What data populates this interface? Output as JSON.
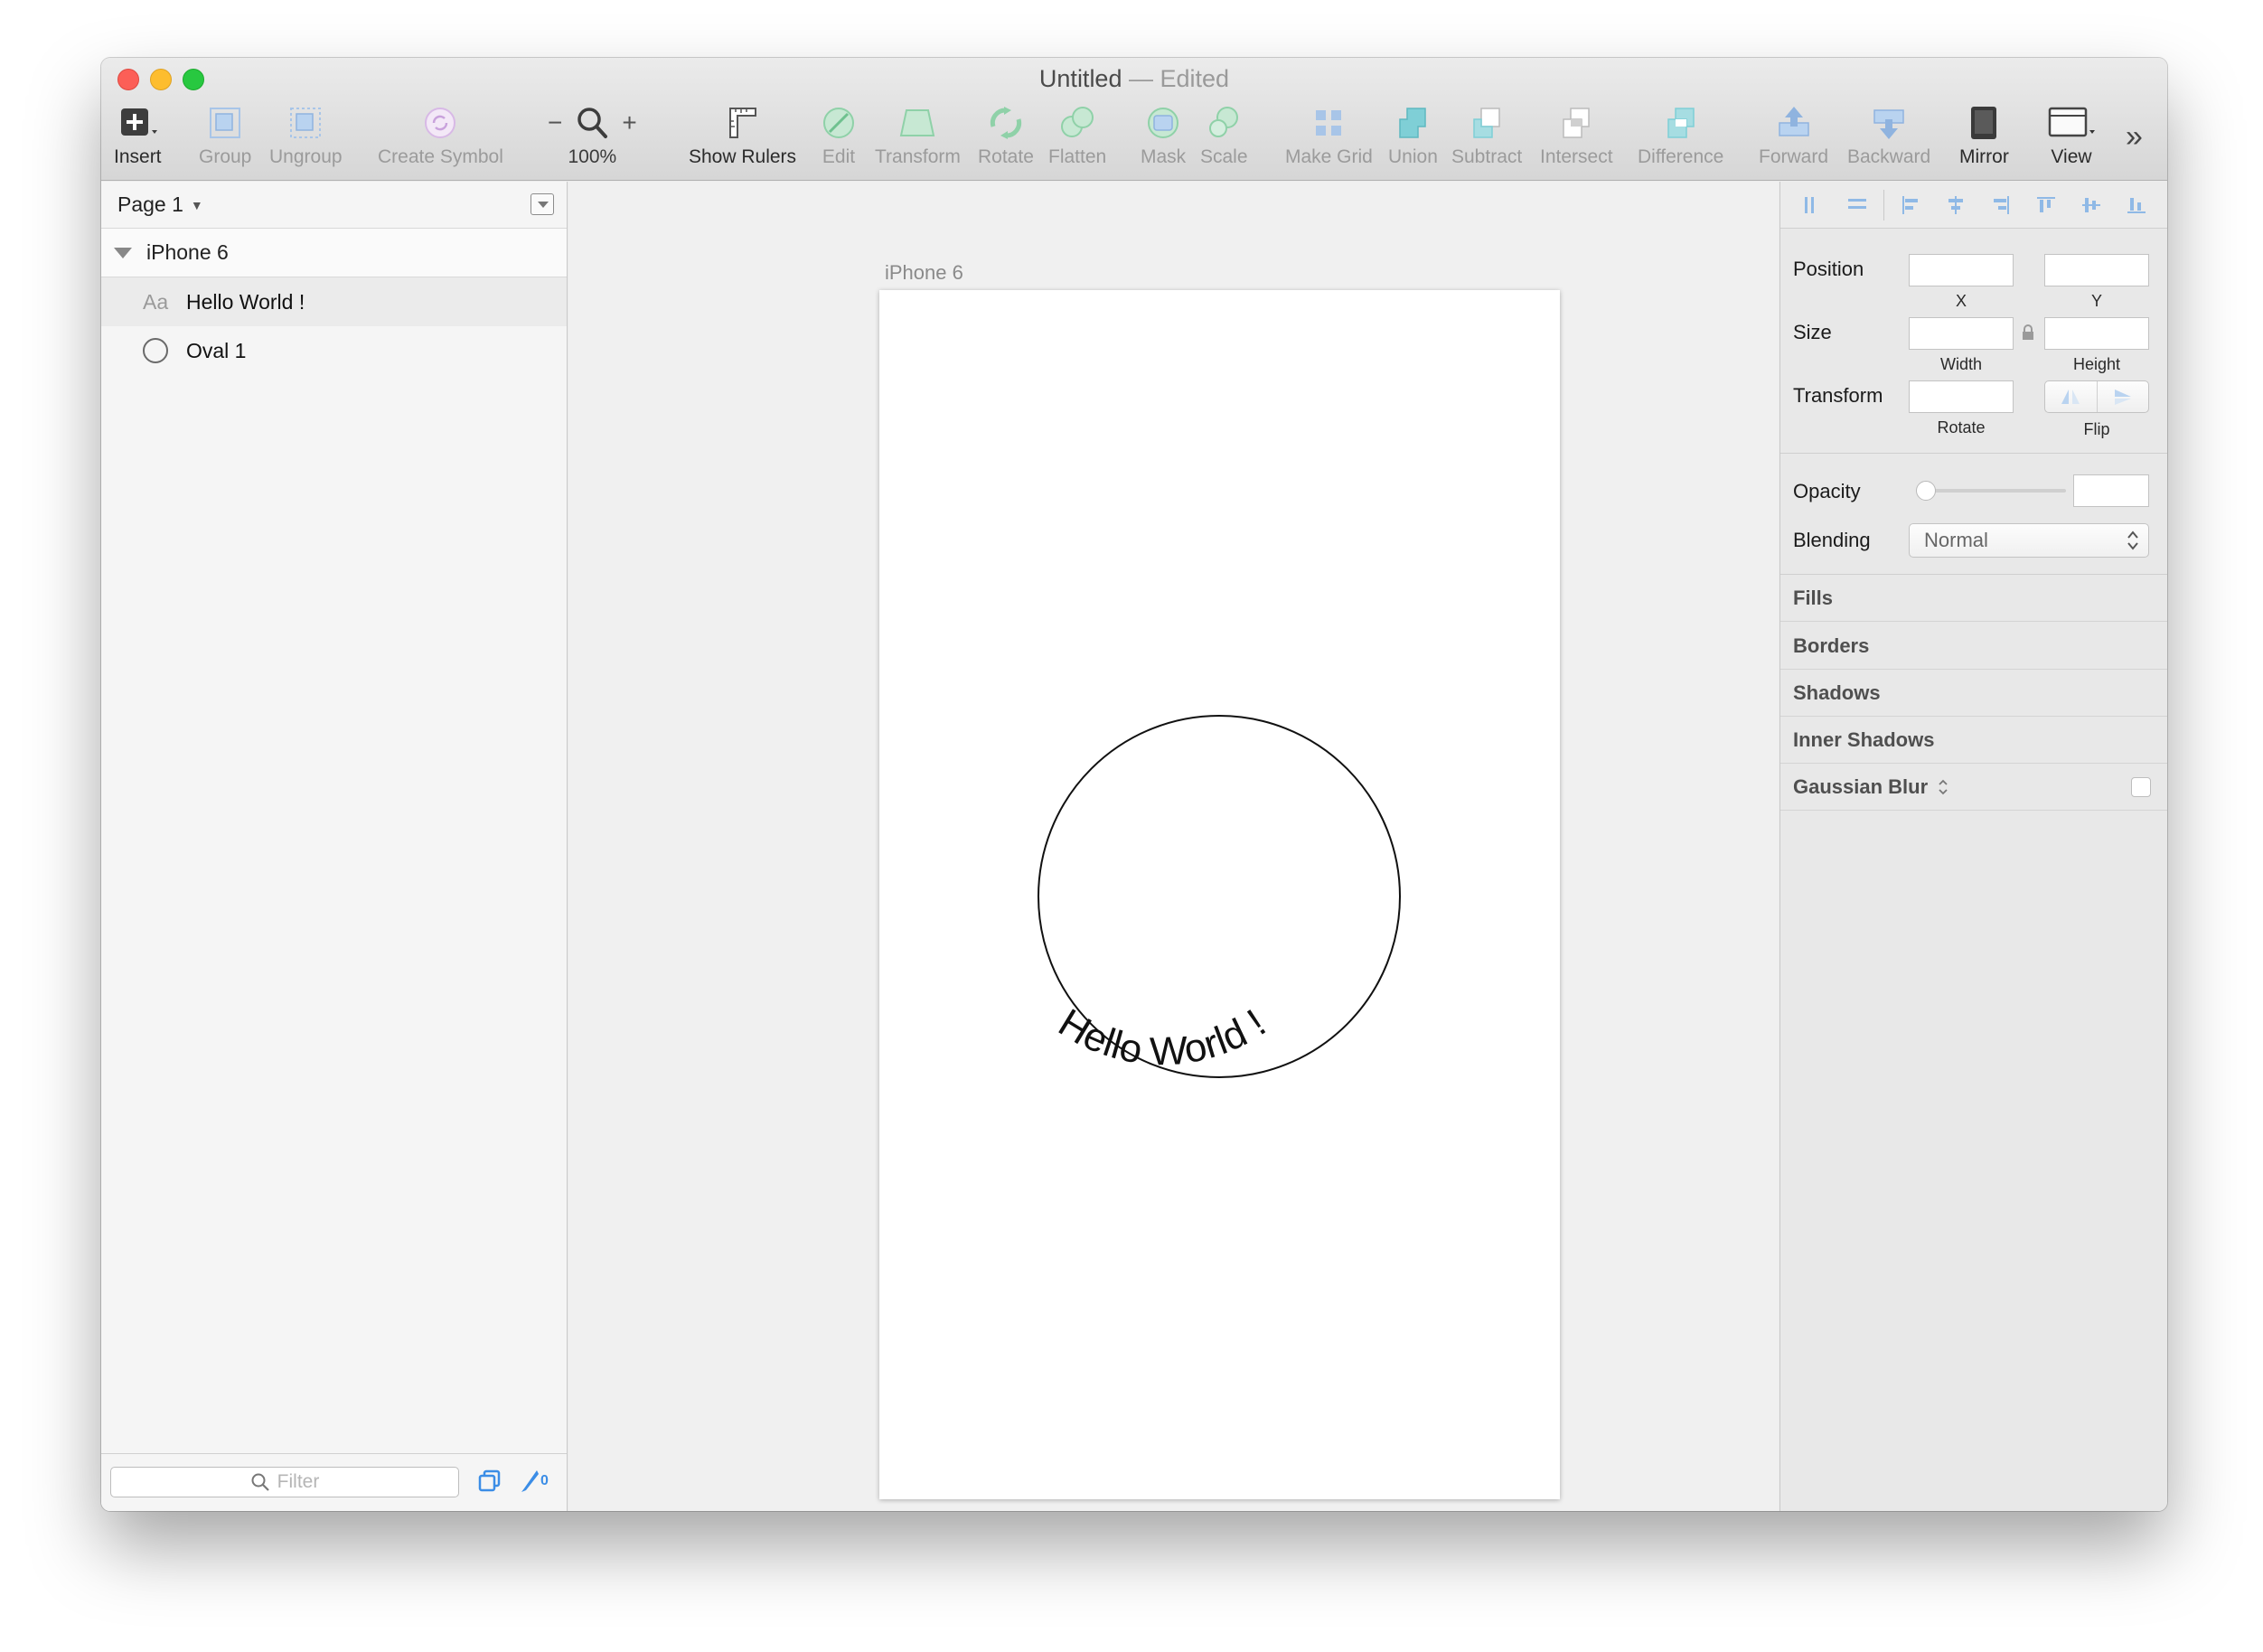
{
  "window": {
    "title": "Untitled",
    "title_separator": "—",
    "title_status": "Edited"
  },
  "toolbar": {
    "insert": "Insert",
    "group": "Group",
    "ungroup": "Ungroup",
    "create_symbol": "Create Symbol",
    "zoom_minus": "−",
    "zoom_plus": "+",
    "zoom_level": "100%",
    "show_rulers": "Show Rulers",
    "edit": "Edit",
    "transform": "Transform",
    "rotate": "Rotate",
    "flatten": "Flatten",
    "mask": "Mask",
    "scale": "Scale",
    "make_grid": "Make Grid",
    "union": "Union",
    "subtract": "Subtract",
    "intersect": "Intersect",
    "difference": "Difference",
    "forward": "Forward",
    "backward": "Backward",
    "mirror": "Mirror",
    "view": "View",
    "overflow": "»"
  },
  "sidebar": {
    "page_name": "Page 1",
    "artboard_name": "iPhone 6",
    "layers": [
      {
        "icon": "Aa",
        "name": "Hello World !"
      },
      {
        "icon": "oval",
        "name": "Oval 1"
      }
    ],
    "filter_placeholder": "Filter",
    "slice_count": "0"
  },
  "canvas": {
    "artboard_label": "iPhone 6",
    "curved_text": "Hello World !"
  },
  "inspector": {
    "position_label": "Position",
    "x_label": "X",
    "y_label": "Y",
    "size_label": "Size",
    "width_label": "Width",
    "height_label": "Height",
    "transform_label": "Transform",
    "rotate_label": "Rotate",
    "flip_label": "Flip",
    "opacity_label": "Opacity",
    "blending_label": "Blending",
    "blending_value": "Normal",
    "sections": [
      "Fills",
      "Borders",
      "Shadows",
      "Inner Shadows",
      "Gaussian Blur"
    ]
  },
  "colors": {
    "accent_blue": "#3b8de6",
    "icon_green": "#8fd1a8",
    "icon_teal": "#7fcfd6",
    "icon_lavender": "#d8b9e6"
  }
}
